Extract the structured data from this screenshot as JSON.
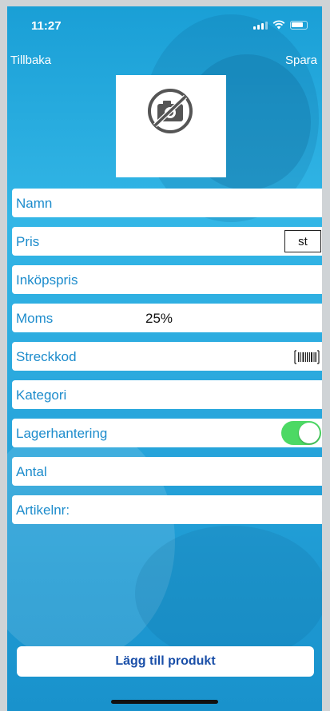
{
  "status_bar": {
    "time": "11:27"
  },
  "nav": {
    "back_label": "Tillbaka",
    "save_label": "Spara"
  },
  "photo": {
    "icon": "no-camera-icon"
  },
  "fields": {
    "name": {
      "label": "Namn"
    },
    "price": {
      "label": "Pris",
      "unit": "st"
    },
    "purchase_price": {
      "label": "Inköpspris"
    },
    "vat": {
      "label": "Moms",
      "value": "25%"
    },
    "barcode": {
      "label": "Streckkod",
      "icon": "barcode-icon"
    },
    "category": {
      "label": "Kategori"
    },
    "inventory": {
      "label": "Lagerhantering",
      "enabled": true
    },
    "quantity": {
      "label": "Antal"
    },
    "article_no": {
      "label": "Artikelnr:"
    }
  },
  "actions": {
    "add_product_label": "Lägg till produkt"
  },
  "colors": {
    "accent": "#1d8ccc",
    "toggle_on": "#4cd964",
    "button_text": "#1a4fa8"
  }
}
